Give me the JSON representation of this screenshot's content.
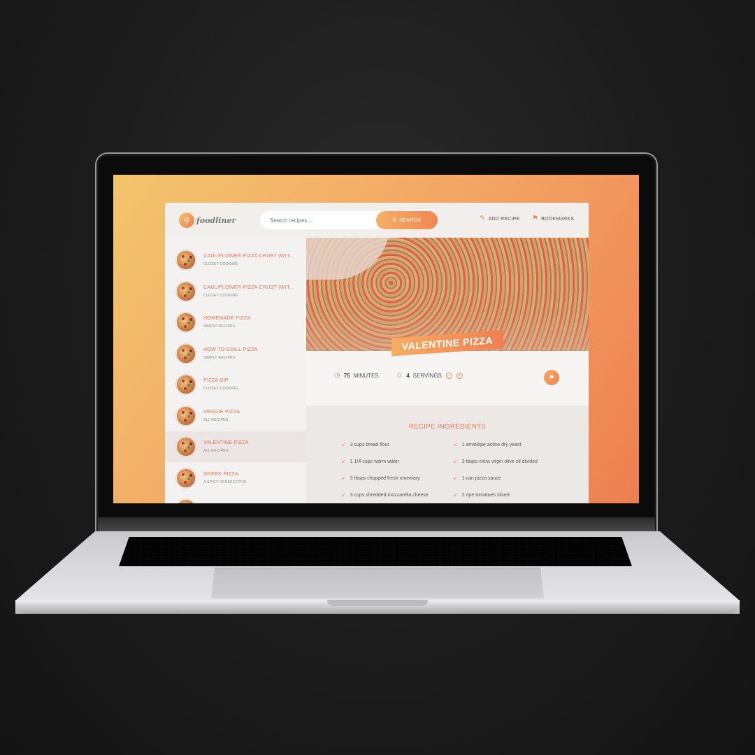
{
  "app": {
    "logo_text": "foodliner"
  },
  "header": {
    "search_placeholder": "Search recipes...",
    "search_button": "SEARCH",
    "add_recipe": "ADD RECIPE",
    "bookmarks": "BOOKMARKS"
  },
  "sidebar": {
    "items": [
      {
        "title": "CAULIFLOWER PIZZA CRUST (WIT...",
        "publisher": "CLOSET COOKING",
        "active": false
      },
      {
        "title": "CAULIFLOWER PIZZA CRUST (WIT...",
        "publisher": "CLOSET COOKING",
        "active": false
      },
      {
        "title": "HOMEMADE PIZZA",
        "publisher": "SIMPLY RECIPES",
        "active": false
      },
      {
        "title": "HOW TO GRILL PIZZA",
        "publisher": "SIMPLY RECIPES",
        "active": false
      },
      {
        "title": "PIZZA DIP",
        "publisher": "CLOSET COOKING",
        "active": false
      },
      {
        "title": "VEGGIE PIZZA",
        "publisher": "ALL RECIPES",
        "active": false
      },
      {
        "title": "VALENTINE PIZZA",
        "publisher": "ALL RECIPES",
        "active": true
      },
      {
        "title": "GREEK PIZZA",
        "publisher": "A SPICY PERSPECTIVE",
        "active": false
      }
    ]
  },
  "recipe": {
    "title": "VALENTINE PIZZA",
    "minutes_value": "75",
    "minutes_label": "MINUTES",
    "servings_value": "4",
    "servings_label": "SERVINGS",
    "ingredients_heading": "RECIPE INGREDIENTS",
    "ingredients": [
      "3 cups bread flour",
      "1 envelope active dry yeast",
      "1 1/4 cups warm water",
      "3 tbsps extra virgin olive oil divided",
      "3 tbsps chopped fresh rosemary",
      "1 can pizza sauce",
      "3 cups shredded mozzarella cheese",
      "2 ripe tomatoes sliced"
    ]
  },
  "colors": {
    "accent": "#ee6d4f",
    "gradient_start": "#f6ae63",
    "gradient_end": "#ef7f52"
  },
  "icons": [
    "fork-knife-icon",
    "search-icon",
    "edit-icon",
    "bookmark-icon",
    "clock-icon",
    "users-icon",
    "minus-circle-icon",
    "plus-circle-icon",
    "check-icon"
  ]
}
